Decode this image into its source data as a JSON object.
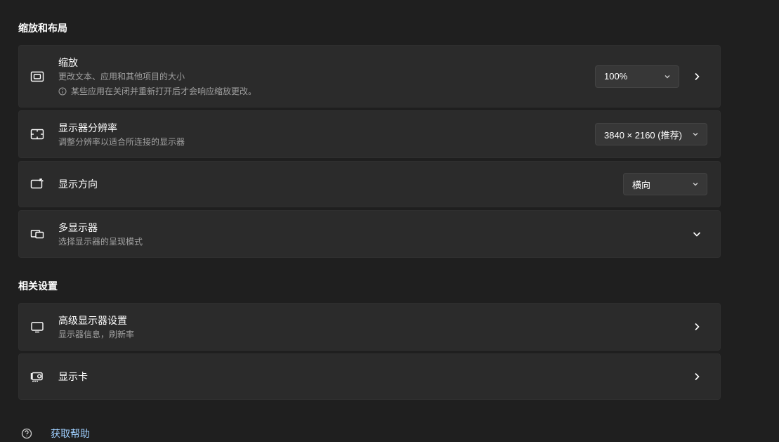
{
  "sections": {
    "scaleLayout": {
      "title": "缩放和布局"
    },
    "related": {
      "title": "相关设置"
    }
  },
  "scale": {
    "title": "缩放",
    "desc": "更改文本、应用和其他项目的大小",
    "warn": "某些应用在关闭并重新打开后才会响应缩放更改。",
    "value": "100%"
  },
  "resolution": {
    "title": "显示器分辨率",
    "desc": "调整分辨率以适合所连接的显示器",
    "value": "3840 × 2160 (推荐)"
  },
  "orientation": {
    "title": "显示方向",
    "value": "横向"
  },
  "multiDisplay": {
    "title": "多显示器",
    "desc": "选择显示器的呈现模式"
  },
  "advanced": {
    "title": "高级显示器设置",
    "desc": "显示器信息，刷新率"
  },
  "graphics": {
    "title": "显示卡"
  },
  "help": {
    "label": "获取帮助"
  }
}
